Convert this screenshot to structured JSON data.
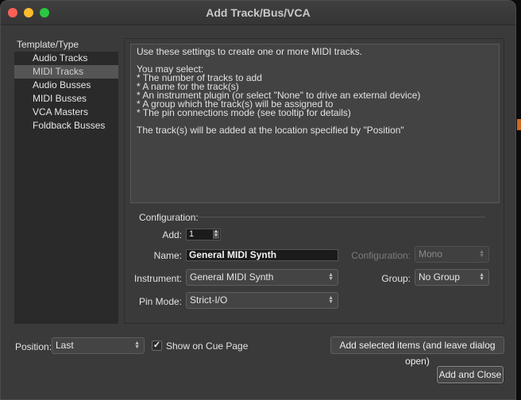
{
  "window": {
    "title": "Add Track/Bus/VCA"
  },
  "sidebar": {
    "heading": "Template/Type",
    "items": [
      {
        "label": "Audio Tracks",
        "selected": false
      },
      {
        "label": "MIDI Tracks",
        "selected": true
      },
      {
        "label": "Audio Busses",
        "selected": false
      },
      {
        "label": "MIDI Busses",
        "selected": false
      },
      {
        "label": "VCA Masters",
        "selected": false
      },
      {
        "label": "Foldback Busses",
        "selected": false
      }
    ]
  },
  "description": {
    "text": "Use these settings to create one or more MIDI tracks.\n\nYou may select:\n* The number of tracks to add\n* A name for the track(s)\n* An instrument plugin (or select \"None\" to drive an external device)\n* A group which the track(s) will be assigned to\n* The pin connections mode (see tooltip for details)\n\nThe track(s) will be added at the location specified by \"Position\""
  },
  "configuration": {
    "heading": "Configuration:",
    "add_label": "Add:",
    "add_value": "1",
    "name_label": "Name:",
    "name_value": "General MIDI Synth",
    "instrument_label": "Instrument:",
    "instrument_value": "General MIDI Synth",
    "pin_mode_label": "Pin Mode:",
    "pin_mode_value": "Strict-I/O",
    "config_label": "Configuration:",
    "config_value": "Mono",
    "group_label": "Group:",
    "group_value": "No Group"
  },
  "footer": {
    "position_label": "Position:",
    "position_value": "Last",
    "cue_label": "Show on Cue Page",
    "cue_checked": true,
    "add_selected_label": "Add selected items (and leave dialog open)",
    "add_close_label": "Add and Close"
  },
  "colors": {
    "close": "#fe5f57",
    "minimize": "#febc2e",
    "maximize": "#28c840",
    "edge_accent": "#d2691e"
  }
}
